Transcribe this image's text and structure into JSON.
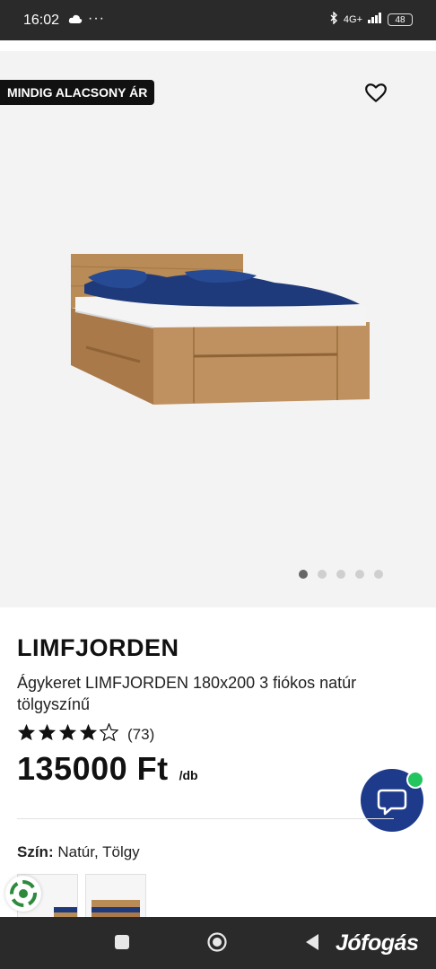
{
  "status_bar": {
    "time": "16:02",
    "dots": "···",
    "network": "4G+",
    "battery": "48"
  },
  "product": {
    "promo_badge": "MINDIG ALACSONY ÁR",
    "brand": "LIMFJORDEN",
    "title": "Ágykeret LIMFJORDEN 180x200 3 fiókos natúr tölgyszínű",
    "rating": {
      "stars": 4,
      "max": 5,
      "count": "(73)"
    },
    "price": "135000 Ft",
    "unit": "/db",
    "color_label": "Szín:",
    "color_value": "Natúr, Tölgy"
  },
  "gallery": {
    "image_count": 5,
    "active_index": 0
  },
  "watermark": "Jófogás",
  "colors": {
    "accent": "#1e3a8a",
    "online": "#22c55e",
    "badge_bg": "#111111",
    "wood": "#b98b56",
    "bedding": "#1f3a7a"
  },
  "icons": {
    "favorite": "heart-icon",
    "chat": "chat-bubble-icon",
    "star_full": "star-icon",
    "star_empty": "star-outline-icon"
  }
}
